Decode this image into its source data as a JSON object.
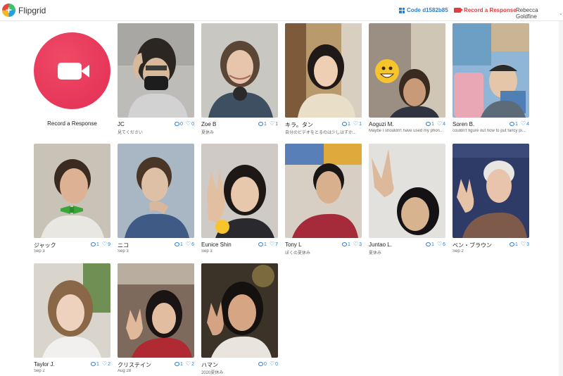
{
  "app": {
    "name": "Flipgrid"
  },
  "header": {
    "code_label": "Code d1582b85",
    "record_label": "Record a Response",
    "user_name": "Rebecca Goldfine"
  },
  "record_tile": {
    "label": "Record a Response"
  },
  "colors": {
    "accent_blue": "#2d7ecb",
    "record_red": "#e32e54",
    "header_red": "#e23c3c"
  },
  "responses": [
    {
      "name": "JC",
      "sub": "見てください",
      "comments": "0",
      "likes": "0",
      "icon": "video-thumbnail"
    },
    {
      "name": "Zoe B",
      "sub": "夏休み",
      "comments": "1",
      "likes": "1",
      "icon": "video-thumbnail"
    },
    {
      "name": "キラ。タン",
      "sub": "自分のビデオをとるのは少しはずか...",
      "comments": "1",
      "likes": "1",
      "icon": "video-thumbnail"
    },
    {
      "name": "Aoguzi M.",
      "sub": "Maybe I shouldn't have used my phon...",
      "comments": "1",
      "likes": "4",
      "icon": "video-thumbnail"
    },
    {
      "name": "Soren B.",
      "sub": "couldn't figure out how to put fancy pi...",
      "comments": "1",
      "likes": "4",
      "icon": "video-thumbnail"
    },
    {
      "name": "ジャック",
      "sub": "Sep 3",
      "comments": "1",
      "likes": "9",
      "icon": "video-thumbnail"
    },
    {
      "name": "ニコ",
      "sub": "Sep 3",
      "comments": "1",
      "likes": "6",
      "icon": "video-thumbnail"
    },
    {
      "name": "Eunice Shin",
      "sub": "Sep 3",
      "comments": "1",
      "likes": "7",
      "icon": "video-thumbnail"
    },
    {
      "name": "Tony L",
      "sub": "ぼくの夏休み",
      "comments": "1",
      "likes": "3",
      "icon": "video-thumbnail"
    },
    {
      "name": "Juntao L.",
      "sub": "夏休み",
      "comments": "1",
      "likes": "6",
      "icon": "video-thumbnail"
    },
    {
      "name": "ベン・ブラウン",
      "sub": "Sep 2",
      "comments": "1",
      "likes": "3",
      "icon": "video-thumbnail"
    },
    {
      "name": "Taylor J.",
      "sub": "Sep 2",
      "comments": "1",
      "likes": "2",
      "icon": "video-thumbnail"
    },
    {
      "name": "クリステイン",
      "sub": "Aug 28",
      "comments": "1",
      "likes": "2",
      "icon": "video-thumbnail"
    },
    {
      "name": "ハマン",
      "sub": "2020夏休み",
      "comments": "0",
      "likes": "0",
      "icon": "video-thumbnail"
    }
  ]
}
